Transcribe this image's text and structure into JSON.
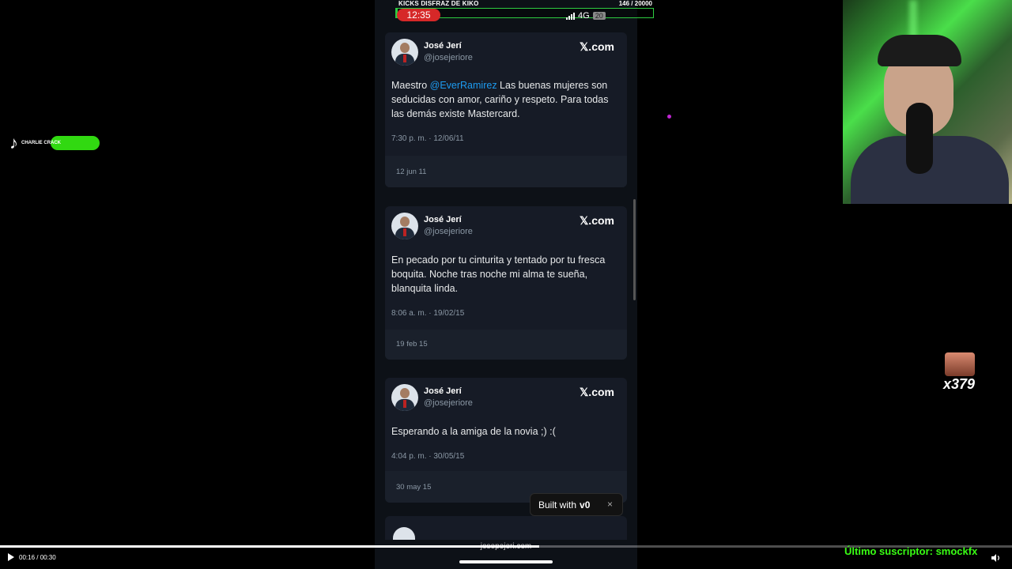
{
  "goal": {
    "title": "KICKS DISFRAZ DE KIKO",
    "count": "146 / 20000",
    "progress": 0.0073,
    "color": "#2ecc40"
  },
  "status_bar": {
    "time": "12:35",
    "network": "4G",
    "battery": "20"
  },
  "tweets": [
    {
      "name": "José Jerí",
      "handle": "@josejeriore",
      "source": "𝕏.com",
      "mention": "@EverRamirez",
      "text_before": "Maestro ",
      "text": " Las buenas mujeres son seducidas con amor, cariño y respeto. Para todas las demás existe Mastercard.",
      "timestamp": "7:30 p. m. · 12/06/11",
      "date": "12 jun 11"
    },
    {
      "name": "José Jerí",
      "handle": "@josejeriore",
      "source": "𝕏.com",
      "text": "En pecado por tu cinturita y tentado por tu fresca boquita. Noche tras noche mi alma te sueña, blanquita linda.",
      "timestamp": "8:06 a. m. · 19/02/15",
      "date": "19 feb 15"
    },
    {
      "name": "José Jerí",
      "handle": "@josejeriore",
      "source": "𝕏.com",
      "text": "Esperando a la amiga de la novia ;) :(",
      "timestamp": "4:04 p. m. · 30/05/15",
      "date": "30 may 15"
    }
  ],
  "built_with": {
    "label": "Built with",
    "brand": "v0",
    "close": "×"
  },
  "browser": {
    "url": "josepejeri.com"
  },
  "player": {
    "time": "00:16 / 00:30",
    "progress": 0.533
  },
  "overlay": {
    "subscriber": "Último suscriptor: smockfx",
    "tiktok_text": "CHARLIE CRACK",
    "sticker_count": "x379"
  },
  "colors": {
    "accent_green": "#39ff14",
    "mention_blue": "#1d9bf0",
    "card_bg": "#161b26"
  }
}
